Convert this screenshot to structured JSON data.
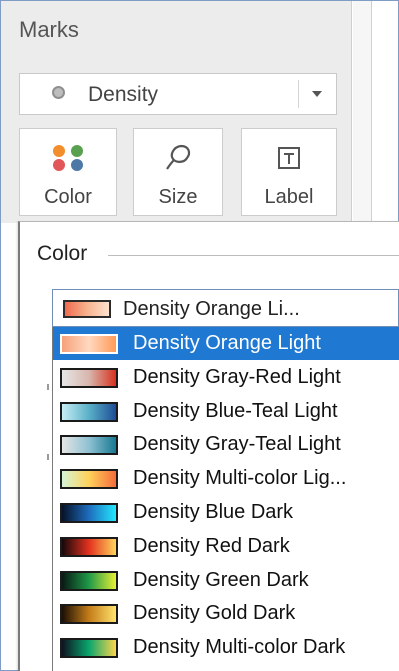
{
  "marks": {
    "title": "Marks",
    "mark_type": {
      "selected": "Density",
      "icon": "circle-icon"
    },
    "cards": [
      {
        "label": "Color",
        "icon": "color-dots-icon"
      },
      {
        "label": "Size",
        "icon": "lasso-icon"
      },
      {
        "label": "Label",
        "icon": "text-box-icon"
      }
    ]
  },
  "color_dialog": {
    "title": "Color",
    "palette_select": {
      "selected_label": "Density Orange Li...",
      "swatch": [
        "#f06a4f",
        "#f7b38d",
        "#fde2cf"
      ]
    },
    "palettes": [
      {
        "label": "Density Orange Light",
        "selected": true,
        "colors": [
          "#f6a17b",
          "#ffd9c0",
          "#ff9a57"
        ]
      },
      {
        "label": "Density Gray-Red Light",
        "selected": false,
        "colors": [
          "#e6e6e6",
          "#d8b6ad",
          "#d7311f"
        ]
      },
      {
        "label": "Density Blue-Teal Light",
        "selected": false,
        "colors": [
          "#c7eef5",
          "#5ab0c8",
          "#1d4d95"
        ]
      },
      {
        "label": "Density Gray-Teal Light",
        "selected": false,
        "colors": [
          "#e5e5e5",
          "#8ec1d2",
          "#177891"
        ]
      },
      {
        "label": "Density Multi-color Light",
        "display_label": "Density Multi-color Lig...",
        "selected": false,
        "colors": [
          "#d4f5d7",
          "#ffd15a",
          "#f46d3b"
        ]
      },
      {
        "label": "Density Blue Dark",
        "selected": false,
        "colors": [
          "#061128",
          "#1e6dbe",
          "#23e8ff"
        ]
      },
      {
        "label": "Density Red Dark",
        "selected": false,
        "colors": [
          "#16070b",
          "#e3321f",
          "#ffd45b"
        ]
      },
      {
        "label": "Density Green Dark",
        "selected": false,
        "colors": [
          "#081814",
          "#1f9a48",
          "#e8ef34"
        ]
      },
      {
        "label": "Density Gold Dark",
        "selected": false,
        "colors": [
          "#1a0f05",
          "#c47c1a",
          "#ffe36c"
        ]
      },
      {
        "label": "Density Multi-color Dark",
        "selected": false,
        "colors": [
          "#0e1220",
          "#0aa66d",
          "#ffd54b"
        ]
      }
    ]
  }
}
